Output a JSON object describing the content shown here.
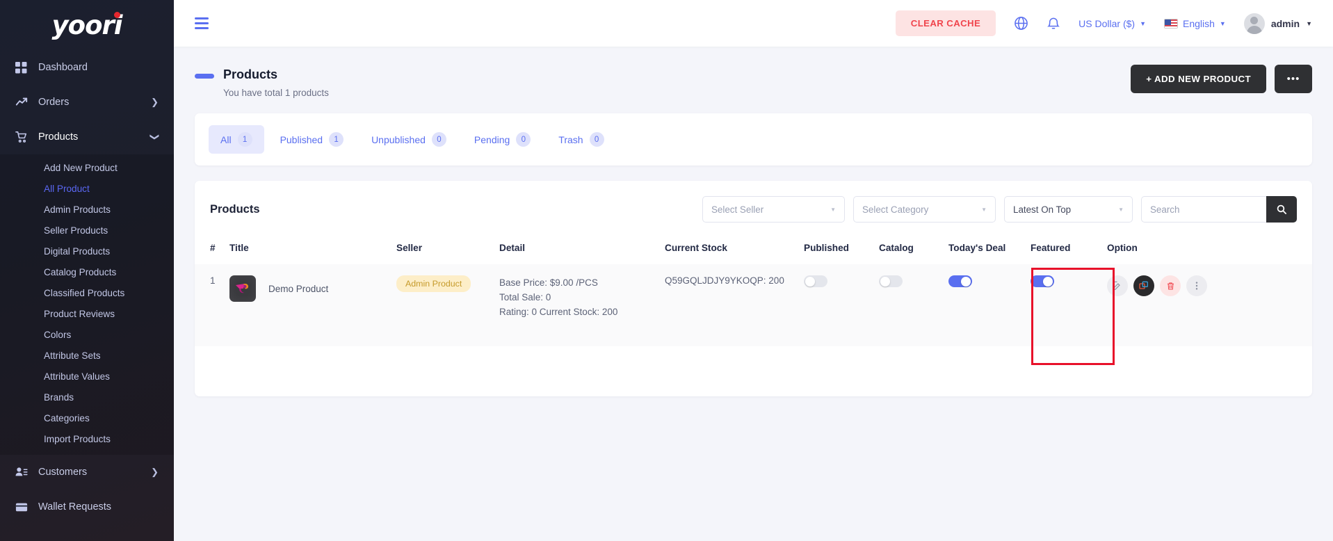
{
  "brand": {
    "name": "yoori"
  },
  "sidebar": {
    "items": [
      {
        "label": "Dashboard",
        "icon": "grid-icon",
        "chevron": "none",
        "active": false
      },
      {
        "label": "Orders",
        "icon": "trending-up-icon",
        "chevron": "right",
        "active": false
      },
      {
        "label": "Products",
        "icon": "cart-icon",
        "chevron": "down",
        "active": true
      },
      {
        "label": "Customers",
        "icon": "users-icon",
        "chevron": "right",
        "active": false
      },
      {
        "label": "Wallet Requests",
        "icon": "wallet-icon",
        "chevron": "right",
        "active": false
      }
    ],
    "products_submenu": [
      {
        "label": "Add New Product",
        "active": false
      },
      {
        "label": "All Product",
        "active": true
      },
      {
        "label": "Admin Products",
        "active": false
      },
      {
        "label": "Seller Products",
        "active": false
      },
      {
        "label": "Digital Products",
        "active": false
      },
      {
        "label": "Catalog Products",
        "active": false
      },
      {
        "label": "Classified Products",
        "active": false
      },
      {
        "label": "Product Reviews",
        "active": false
      },
      {
        "label": "Colors",
        "active": false
      },
      {
        "label": "Attribute Sets",
        "active": false
      },
      {
        "label": "Attribute Values",
        "active": false
      },
      {
        "label": "Brands",
        "active": false
      },
      {
        "label": "Categories",
        "active": false
      },
      {
        "label": "Import Products",
        "active": false
      }
    ]
  },
  "topbar": {
    "clear_cache": "CLEAR CACHE",
    "currency": "US Dollar ($)",
    "language": "English",
    "account": "admin"
  },
  "page": {
    "title": "Products",
    "subtitle": "You have total 1 products",
    "add_button": "+ ADD NEW PRODUCT",
    "more_button": "•••"
  },
  "tabs": [
    {
      "label": "All",
      "count": "1",
      "active": true
    },
    {
      "label": "Published",
      "count": "1",
      "active": false
    },
    {
      "label": "Unpublished",
      "count": "0",
      "active": false
    },
    {
      "label": "Pending",
      "count": "0",
      "active": false
    },
    {
      "label": "Trash",
      "count": "0",
      "active": false
    }
  ],
  "list": {
    "title": "Products",
    "select_seller": "Select Seller",
    "select_category": "Select Category",
    "sort": "Latest On Top",
    "search_placeholder": "Search",
    "search_value": ""
  },
  "table": {
    "headers": [
      "#",
      "Title",
      "Seller",
      "Detail",
      "Current Stock",
      "Published",
      "Catalog",
      "Today's Deal",
      "Featured",
      "Option"
    ],
    "rows": [
      {
        "index": "1",
        "title": "Demo Product",
        "seller_badge": "Admin Product",
        "detail_price": "Base Price: $9.00 /PCS",
        "detail_sale": "Total Sale: 0",
        "detail_rating": "Rating: 0 Current Stock: 200",
        "current_stock": "Q59GQLJDJY9YKOQP: 200",
        "published": false,
        "catalog": false,
        "todays_deal": true,
        "featured": true
      }
    ]
  },
  "colors": {
    "accent": "#5a6ff0",
    "danger": "#f0444c",
    "dark": "#2f3033",
    "annotation": "#e8112a",
    "badge_yellow": "#fdeec8"
  }
}
